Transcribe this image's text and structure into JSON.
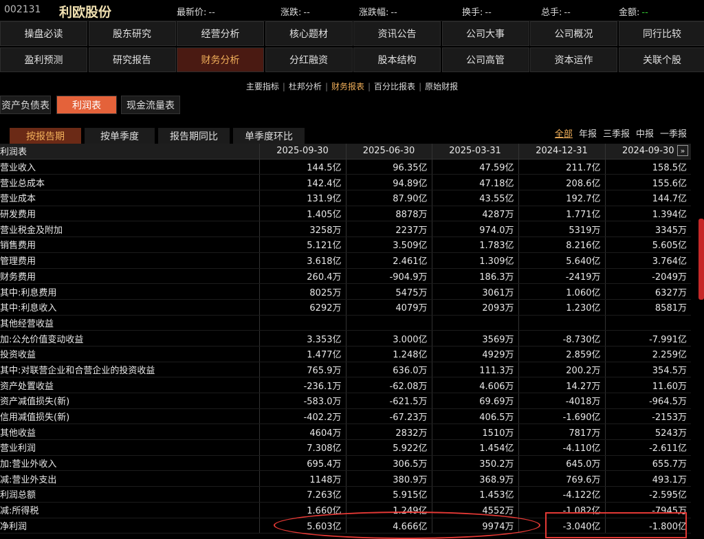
{
  "header": {
    "code": "002131",
    "name": "利欧股份",
    "quotes": [
      {
        "label": "最新价:",
        "value": "--"
      },
      {
        "label": "涨跌:",
        "value": "--"
      },
      {
        "label": "涨跌幅:",
        "value": "--"
      },
      {
        "label": "换手:",
        "value": "--"
      },
      {
        "label": "总手:",
        "value": "--"
      },
      {
        "label": "金额:",
        "value": "--"
      }
    ]
  },
  "nav_row1": [
    "操盘必读",
    "股东研究",
    "经营分析",
    "核心题材",
    "资讯公告",
    "公司大事",
    "公司概况",
    "同行比较"
  ],
  "nav_row2": [
    "盈利预测",
    "研究报告",
    "财务分析",
    "分红融资",
    "股本结构",
    "公司高管",
    "资本运作",
    "关联个股"
  ],
  "nav_row2_active": 2,
  "subnav": [
    "主要指标",
    "杜邦分析",
    "财务报表",
    "百分比报表",
    "原始财报"
  ],
  "subnav_active": 2,
  "statement_tabs": [
    "资产负债表",
    "利润表",
    "现金流量表"
  ],
  "statement_active": 1,
  "period_tabs": [
    "按报告期",
    "按单季度",
    "报告期同比",
    "单季度环比"
  ],
  "period_active": 0,
  "filters": [
    "全部",
    "年报",
    "三季报",
    "中报",
    "一季报"
  ],
  "filters_active": 0,
  "expand_symbol": "»",
  "table": {
    "title": "利润表",
    "columns": [
      "2025-09-30",
      "2025-06-30",
      "2025-03-31",
      "2024-12-31",
      "2024-09-30"
    ],
    "rows": [
      {
        "label": "营业收入",
        "indent": 1,
        "values": [
          "144.5亿",
          "96.35亿",
          "47.59亿",
          "211.7亿",
          "158.5亿"
        ]
      },
      {
        "label": "营业总成本",
        "indent": 0,
        "values": [
          "142.4亿",
          "94.89亿",
          "47.18亿",
          "208.6亿",
          "155.6亿"
        ]
      },
      {
        "label": "营业成本",
        "indent": 1,
        "values": [
          "131.9亿",
          "87.90亿",
          "43.55亿",
          "192.7亿",
          "144.7亿"
        ]
      },
      {
        "label": "研发费用",
        "indent": 1,
        "values": [
          "1.405亿",
          "8878万",
          "4287万",
          "1.771亿",
          "1.394亿"
        ]
      },
      {
        "label": "营业税金及附加",
        "indent": 1,
        "values": [
          "3258万",
          "2237万",
          "974.0万",
          "5319万",
          "3345万"
        ]
      },
      {
        "label": "销售费用",
        "indent": 1,
        "values": [
          "5.121亿",
          "3.509亿",
          "1.783亿",
          "8.216亿",
          "5.605亿"
        ]
      },
      {
        "label": "管理费用",
        "indent": 1,
        "values": [
          "3.618亿",
          "2.461亿",
          "1.309亿",
          "5.640亿",
          "3.764亿"
        ]
      },
      {
        "label": "财务费用",
        "indent": 1,
        "values": [
          "260.4万",
          "-904.9万",
          "186.3万",
          "-2419万",
          "-2049万"
        ]
      },
      {
        "label": "其中:利息费用",
        "indent": 1,
        "values": [
          "8025万",
          "5475万",
          "3061万",
          "1.060亿",
          "6327万"
        ]
      },
      {
        "label": "其中:利息收入",
        "indent": 1,
        "values": [
          "6292万",
          "4079万",
          "2093万",
          "1.230亿",
          "8581万"
        ]
      },
      {
        "label": "其他经营收益",
        "indent": 0,
        "values": [
          "",
          "",
          "",
          "",
          ""
        ]
      },
      {
        "label": "加:公允价值变动收益",
        "indent": 1,
        "values": [
          "3.353亿",
          "3.000亿",
          "3569万",
          "-8.730亿",
          "-7.991亿"
        ]
      },
      {
        "label": "投资收益",
        "indent": 2,
        "values": [
          "1.477亿",
          "1.248亿",
          "4929万",
          "2.859亿",
          "2.259亿"
        ]
      },
      {
        "label": "其中:对联营企业和合营企业的投资收益",
        "indent": 1,
        "values": [
          "765.9万",
          "636.0万",
          "111.3万",
          "200.2万",
          "354.5万"
        ]
      },
      {
        "label": "资产处置收益",
        "indent": 1,
        "values": [
          "-236.1万",
          "-62.08万",
          "4.606万",
          "14.27万",
          "11.60万"
        ]
      },
      {
        "label": "资产减值损失(新)",
        "indent": 1,
        "values": [
          "-583.0万",
          "-621.5万",
          "69.69万",
          "-4018万",
          "-964.5万"
        ]
      },
      {
        "label": "信用减值损失(新)",
        "indent": 1,
        "values": [
          "-402.2万",
          "-67.23万",
          "406.5万",
          "-1.690亿",
          "-2153万"
        ]
      },
      {
        "label": "其他收益",
        "indent": 1,
        "values": [
          "4604万",
          "2832万",
          "1510万",
          "7817万",
          "5243万"
        ]
      },
      {
        "label": "营业利润",
        "indent": 0,
        "values": [
          "7.308亿",
          "5.922亿",
          "1.454亿",
          "-4.110亿",
          "-2.611亿"
        ]
      },
      {
        "label": "加:营业外收入",
        "indent": 1,
        "values": [
          "695.4万",
          "306.5万",
          "350.2万",
          "645.0万",
          "655.7万"
        ]
      },
      {
        "label": "减:营业外支出",
        "indent": 1,
        "values": [
          "1148万",
          "380.9万",
          "368.9万",
          "769.6万",
          "493.1万"
        ]
      },
      {
        "label": "利润总额",
        "indent": 0,
        "values": [
          "7.263亿",
          "5.915亿",
          "1.453亿",
          "-4.122亿",
          "-2.595亿"
        ]
      },
      {
        "label": "减:所得税",
        "indent": 1,
        "values": [
          "1.660亿",
          "1.249亿",
          "4552万",
          "-1.082亿",
          "-7945万"
        ]
      },
      {
        "label": "净利润",
        "indent": 0,
        "values": [
          "5.603亿",
          "4.666亿",
          "9974万",
          "-3.040亿",
          "-1.800亿"
        ]
      }
    ]
  },
  "chart_data": {
    "type": "table",
    "title": "利润表",
    "columns": [
      "2025-09-30",
      "2025-06-30",
      "2025-03-31",
      "2024-12-31",
      "2024-09-30"
    ]
  },
  "colors": {
    "accent": "#f2b05a",
    "active_tab": "#e4623a",
    "highlight": "#e53935"
  }
}
